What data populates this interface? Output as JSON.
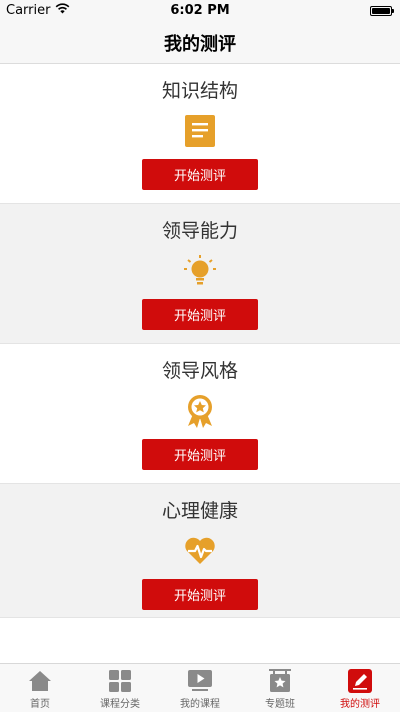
{
  "status_bar": {
    "carrier": "Carrier",
    "time": "6:02 PM"
  },
  "nav": {
    "title": "我的测评"
  },
  "sections": [
    {
      "title": "知识结构",
      "icon": "document-icon",
      "button": "开始测评"
    },
    {
      "title": "领导能力",
      "icon": "lightbulb-icon",
      "button": "开始测评"
    },
    {
      "title": "领导风格",
      "icon": "medal-icon",
      "button": "开始测评"
    },
    {
      "title": "心理健康",
      "icon": "heart-pulse-icon",
      "button": "开始测评"
    }
  ],
  "tabs": [
    {
      "label": "首页",
      "icon": "home-icon",
      "active": false
    },
    {
      "label": "课程分类",
      "icon": "grid-icon",
      "active": false
    },
    {
      "label": "我的课程",
      "icon": "play-icon",
      "active": false
    },
    {
      "label": "专题班",
      "icon": "star-board-icon",
      "active": false
    },
    {
      "label": "我的测评",
      "icon": "edit-icon",
      "active": true
    }
  ],
  "colors": {
    "accent": "#d00c0c",
    "icon_gold": "#e6a02a",
    "tab_gray": "#8a8a8a"
  }
}
